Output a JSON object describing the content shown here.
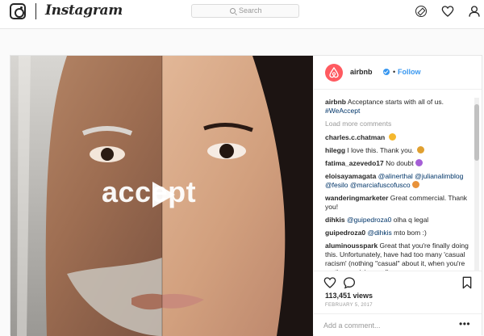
{
  "nav": {
    "wordmark": "Instagram",
    "search_placeholder": "Search"
  },
  "media": {
    "overlay_text": "accept"
  },
  "post": {
    "username": "airbnb",
    "separator": "•",
    "follow_label": "Follow",
    "caption": {
      "user": "airbnb",
      "text": " Acceptance starts with all of us. ",
      "hashtag": "#WeAccept"
    },
    "load_more": "Load more comments",
    "comments": [
      {
        "user": "charles.c.chatman",
        "text": "",
        "emoji_color": "#f5b82e"
      },
      {
        "user": "hilegg",
        "text": " I love this. Thank you. ",
        "emoji_color": "#e0a030"
      },
      {
        "user": "fatima_azevedo17",
        "text": " No doubt",
        "emoji_color": "#a55fd6"
      },
      {
        "user": "eloisayamagata",
        "text": "",
        "tags": "@alinerthal @julianalimblog @fesilo @marciafuscofusco",
        "emoji_color": "#e8923a"
      },
      {
        "user": "wanderingmarketer",
        "text": " Great commercial. Thank you!"
      },
      {
        "user": "dihkis",
        "text": "",
        "tags": "@guipedroza0",
        "after": " olha q legal"
      },
      {
        "user": "guipedroza0",
        "text": "",
        "tags": "@dihkis",
        "after": " mto bom :)"
      },
      {
        "user": "aluminousspark",
        "text": " Great that you're finally doing this. Unfortunately, have had too many 'casual racism' (nothing \"casual\" about it, when you're on the receiving end)"
      }
    ],
    "views": "113,451 views",
    "date": "FEBRUARY 5, 2017",
    "add_comment_placeholder": "Add a comment...",
    "more_label": "•••"
  },
  "colors": {
    "brand_airbnb": "#ff5a60",
    "link_blue": "#3897f0",
    "hashtag": "#003569"
  }
}
